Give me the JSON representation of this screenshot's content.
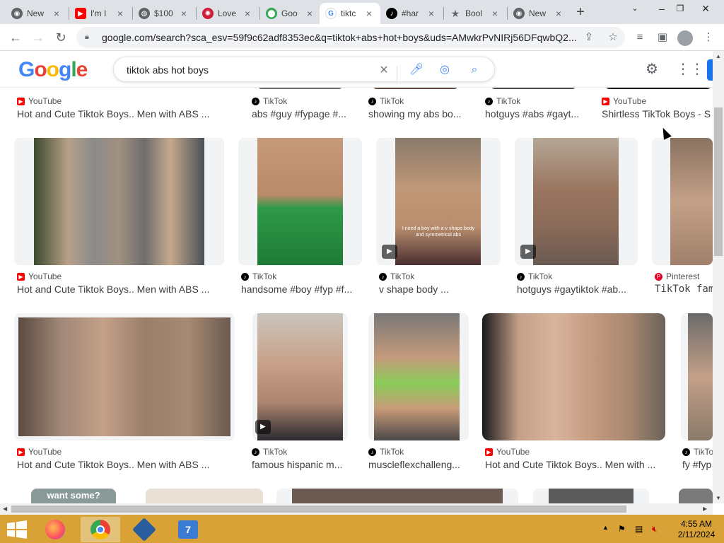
{
  "browser": {
    "tabs": [
      {
        "label": "New",
        "icon": "chrome-icon",
        "color": "#5f6368"
      },
      {
        "label": "I'm I",
        "icon": "youtube-icon",
        "color": "#ff0000"
      },
      {
        "label": "$100",
        "icon": "globe-icon",
        "color": "#5f6368"
      },
      {
        "label": "Love",
        "icon": "site-icon",
        "color": "#cc1d3a"
      },
      {
        "label": "Goo",
        "icon": "maps-icon",
        "color": "#34a853"
      },
      {
        "label": "tiktc",
        "icon": "google-icon",
        "color": "#4285f4"
      },
      {
        "label": "#har",
        "icon": "tiktok-icon",
        "color": "#000000"
      },
      {
        "label": "Bool",
        "icon": "star-icon",
        "color": "#5f6368"
      },
      {
        "label": "New",
        "icon": "chrome-icon",
        "color": "#5f6368"
      }
    ],
    "active_tab": 5,
    "new_tab_label": "+",
    "url": "google.com/search?sca_esv=59f9c62adf8353ec&q=tiktok+abs+hot+boys&uds=AMwkrPvNIRj56DFqwbQ2..."
  },
  "google": {
    "logo_text": "Google",
    "query": "tiktok abs hot boys"
  },
  "results": {
    "row0": [
      {
        "source": "YouTube",
        "stype": "yt",
        "title": "Hot and Cute Tiktok Boys.. Men with ABS ..."
      },
      {
        "source": "TikTok",
        "stype": "tt",
        "title": "abs #guy #fypage #..."
      },
      {
        "source": "TikTok",
        "stype": "tt",
        "title": "showing my abs bo..."
      },
      {
        "source": "TikTok",
        "stype": "tt",
        "title": "hotguys #abs #gayt..."
      },
      {
        "source": "YouTube",
        "stype": "yt",
        "title": "Shirtless TikTok Boys - S"
      }
    ],
    "row1": [
      {
        "source": "YouTube",
        "stype": "yt",
        "title": "Hot and Cute Tiktok Boys.. Men with ABS ..."
      },
      {
        "source": "TikTok",
        "stype": "tt",
        "title": "handsome #boy #fyp #f..."
      },
      {
        "source": "TikTok",
        "stype": "tt",
        "title": "v shape body ..."
      },
      {
        "source": "TikTok",
        "stype": "tt",
        "title": "hotguys #gaytiktok #ab..."
      },
      {
        "source": "Pinterest",
        "stype": "pin",
        "title": "TikTok fam"
      }
    ],
    "row2": [
      {
        "source": "YouTube",
        "stype": "yt",
        "title": "Hot and Cute Tiktok Boys.. Men with ABS ..."
      },
      {
        "source": "TikTok",
        "stype": "tt",
        "title": "famous hispanic m..."
      },
      {
        "source": "TikTok",
        "stype": "tt",
        "title": "muscleflexchalleng..."
      },
      {
        "source": "YouTube",
        "stype": "yt",
        "title": "Hot and Cute Tiktok Boys.. Men with ..."
      },
      {
        "source": "TikTok",
        "stype": "tt",
        "title": "fy #fyp"
      }
    ],
    "row3_overlay": "want some?",
    "thumb_caption": "I need a boy with a v shape body and symmetrical abs"
  },
  "taskbar": {
    "time": "4:55 AM",
    "date": "2/11/2024"
  },
  "colors": {
    "taskbar": "#d8a237",
    "google_blue": "#4285f4",
    "google_red": "#ea4335",
    "google_yellow": "#fbbc05",
    "google_green": "#34a853"
  }
}
